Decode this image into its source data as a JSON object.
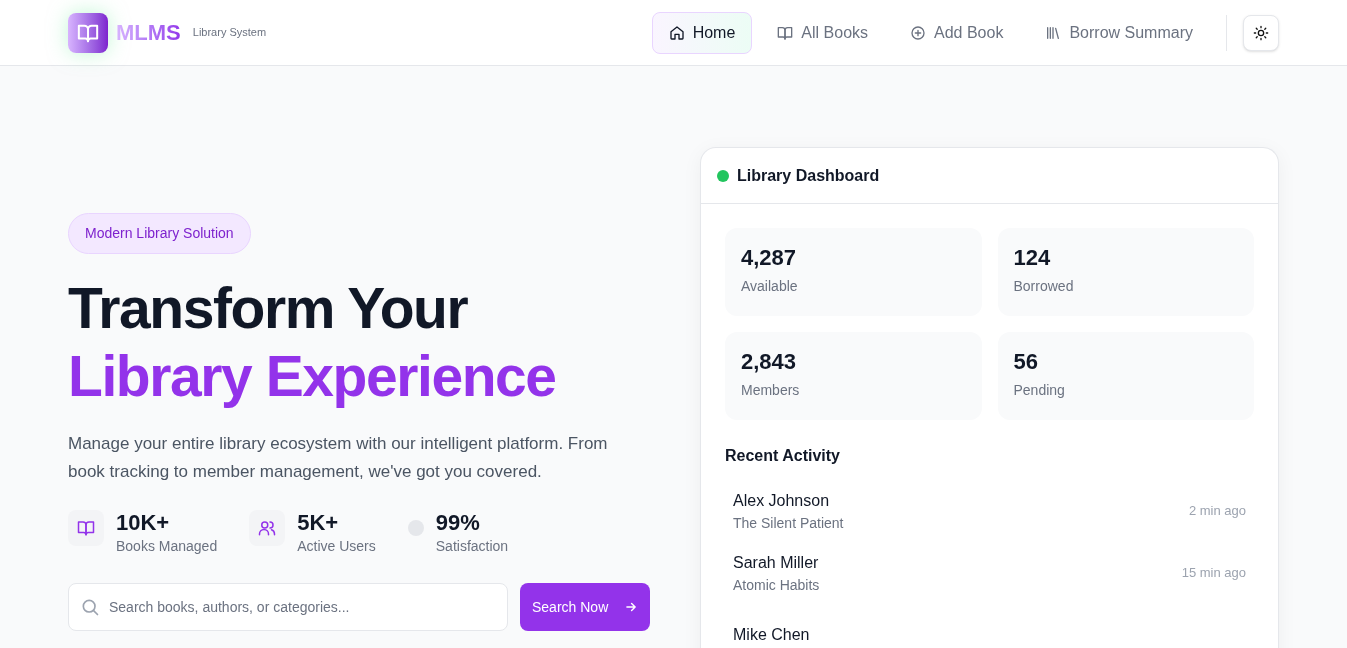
{
  "header": {
    "logo": "MLMS",
    "tagline": "Library System",
    "nav": [
      {
        "label": "Home",
        "kind": "home",
        "selected": true
      },
      {
        "label": "All Books",
        "kind": "book",
        "selected": false
      },
      {
        "label": "Add Book",
        "kind": "plus",
        "selected": false
      },
      {
        "label": "Borrow Summary",
        "kind": "shelf",
        "selected": false
      }
    ]
  },
  "hero": {
    "badge": "Modern Library Solution",
    "title_line_1": "Transform Your",
    "title_line_2": "Library Experience",
    "description": "Manage your entire library ecosystem with our intelligent platform. From book tracking to member management, we've got you covered.",
    "stats": [
      {
        "kind": "book",
        "value": "10K+",
        "label": "Books Managed"
      },
      {
        "kind": "users",
        "value": "5K+",
        "label": "Active Users"
      },
      {
        "kind": "blank",
        "value": "99%",
        "label": "Satisfaction"
      }
    ],
    "search": {
      "placeholder": "Search books, authors, or categories...",
      "button": "Search Now"
    }
  },
  "dashboard": {
    "title": "Library Dashboard",
    "metrics": [
      {
        "value": "4,287",
        "label": "Available"
      },
      {
        "value": "124",
        "label": "Borrowed"
      },
      {
        "value": "2,843",
        "label": "Members"
      },
      {
        "value": "56",
        "label": "Pending"
      }
    ],
    "recent_activity": {
      "title": "Recent Activity",
      "items": [
        {
          "name": "Alex Johnson",
          "book": "The Silent Patient",
          "time": "2 min ago"
        },
        {
          "name": "Sarah Miller",
          "book": "Atomic Habits",
          "time": "15 min ago"
        },
        {
          "name": "Mike Chen"
        }
      ]
    }
  }
}
